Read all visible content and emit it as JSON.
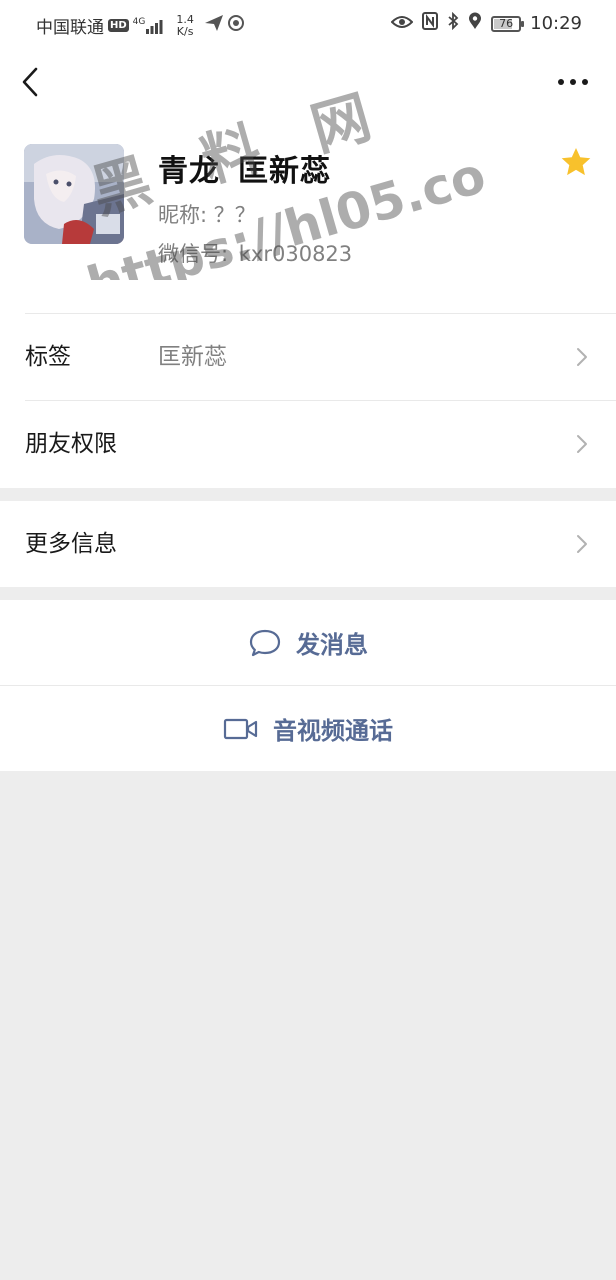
{
  "status_bar": {
    "carrier": "中国联通",
    "hd_badge": "HD",
    "network_type": "4G",
    "net_speed_value": "1.4",
    "net_speed_unit": "K/s",
    "battery_level": "76",
    "battery_fraction": 0.76,
    "time": "10:29"
  },
  "profile": {
    "display_name": "青龙",
    "remark_name": "匡新蕊",
    "nickname_label": "昵称:",
    "nickname_value": "？？",
    "wechat_id_label": "微信号:",
    "wechat_id_value": "kxr030823",
    "starred": true
  },
  "rows": {
    "tags_label": "标签",
    "tags_value": "匡新蕊",
    "friend_permissions_label": "朋友权限",
    "more_info_label": "更多信息"
  },
  "actions": {
    "send_message_label": "发消息",
    "av_call_label": "音视频通话"
  },
  "watermark": {
    "text_cn": "黑 料 网",
    "text_url": "https://hl05.co"
  },
  "colors": {
    "link_blue": "#576b95",
    "star_gold": "#f8c12c",
    "page_bg": "#ededed"
  },
  "icons": {
    "back": "chevron-left-icon",
    "more": "more-dots-icon",
    "star": "star-icon",
    "chevron": "chevron-right-icon",
    "message": "chat-bubble-icon",
    "video": "video-camera-icon"
  }
}
